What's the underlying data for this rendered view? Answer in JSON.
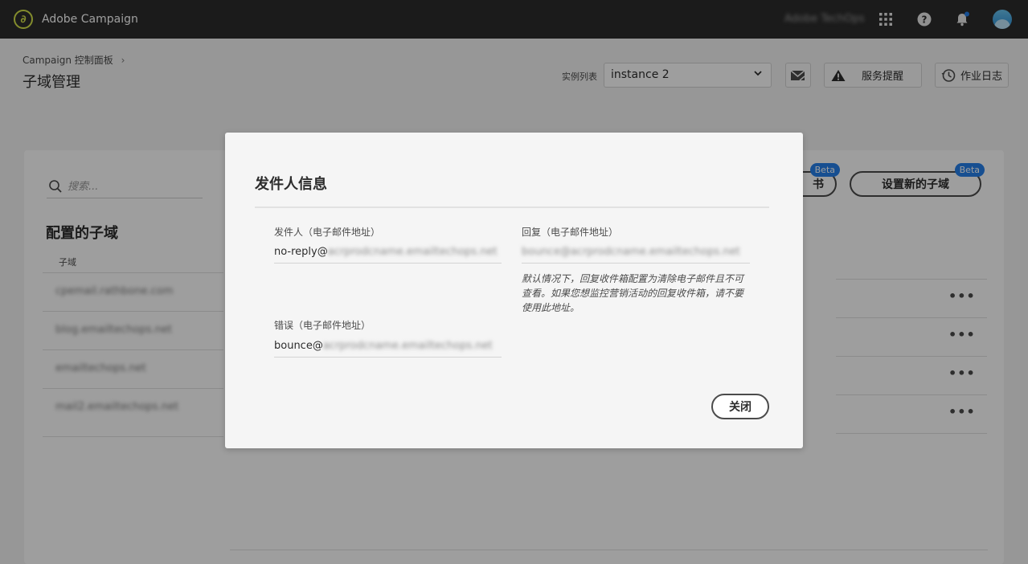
{
  "topbar": {
    "app_name": "Adobe Campaign",
    "org_name": "Adobe TechOps"
  },
  "header": {
    "breadcrumb": "Campaign 控制面板",
    "title": "子域管理",
    "instance_label": "实例列表",
    "instance_value": "instance 2",
    "alerts_label": "服务提醒",
    "log_label": "作业日志"
  },
  "sidebar": {
    "search_placeholder": "搜索...",
    "title": "配置的子域",
    "column_header": "子域",
    "items": [
      {
        "label": "cpemail.rathbone.com"
      },
      {
        "label": "blog.emailtechops.net"
      },
      {
        "label": "emailtechops.net"
      },
      {
        "label": "mail2.emailtechops.net"
      }
    ]
  },
  "actions": {
    "cert_label": "书",
    "new_subdomain_label": "设置新的子域",
    "beta": "Beta"
  },
  "dialog": {
    "title": "发件人信息",
    "from_label": "发件人（电子邮件地址）",
    "from_prefix": "no-reply@",
    "from_domain": "acrprodcname.emailtechops.net",
    "reply_label": "回复（电子邮件地址）",
    "reply_value": "bounce@acrprodcname.emailtechops.net",
    "reply_note": "默认情况下，回复收件箱配置为清除电子邮件且不可查看。如果您想监控营销活动的回复收件箱，请不要使用此地址。",
    "error_label": "错误（电子邮件地址）",
    "error_prefix": "bounce@",
    "error_domain": "acrprodcname.emailtechops.net",
    "close_label": "关闭"
  }
}
